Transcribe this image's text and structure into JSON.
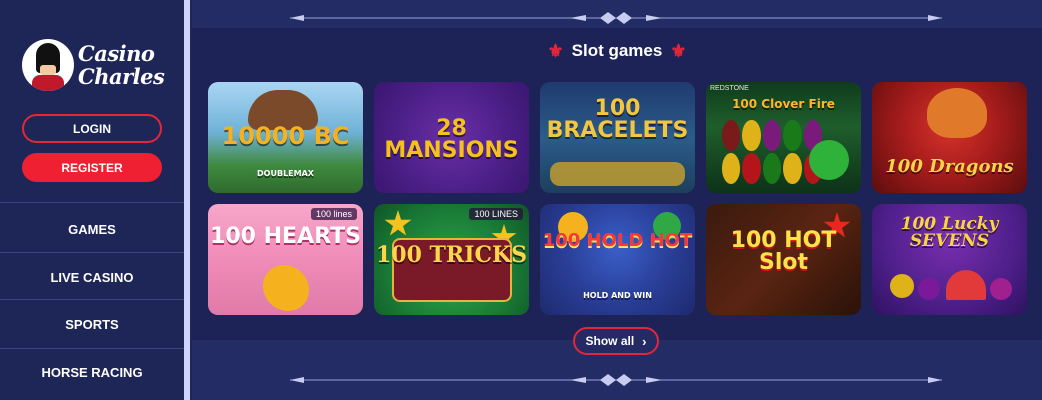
{
  "logo": {
    "line1": "Casino",
    "line2": "Charles"
  },
  "auth": {
    "login_label": "LOGIN",
    "register_label": "REGISTER"
  },
  "nav": [
    {
      "label": "GAMES"
    },
    {
      "label": "LIVE CASINO"
    },
    {
      "label": "SPORTS"
    },
    {
      "label": "HORSE RACING"
    }
  ],
  "section": {
    "title": "Slot games",
    "fleur": "⚜",
    "show_all_label": "Show all",
    "show_all_icon": "chevron-right-icon"
  },
  "games": [
    {
      "title": "10000 BC",
      "subtitle": "DOUBLEMAX",
      "tag": "",
      "brand": ""
    },
    {
      "title": "28 MANSIONS",
      "subtitle": "",
      "tag": "",
      "brand": ""
    },
    {
      "title": "100 BRACELETS",
      "subtitle": "",
      "tag": "",
      "brand": ""
    },
    {
      "title": "100 Clover Fire",
      "subtitle": "",
      "tag": "",
      "brand": "REDSTONE"
    },
    {
      "title": "100 Dragons",
      "subtitle": "",
      "tag": "",
      "brand": ""
    },
    {
      "title": "100 HEARTS",
      "subtitle": "",
      "tag": "100 lines",
      "brand": ""
    },
    {
      "title": "100 TRICKS",
      "subtitle": "",
      "tag": "100 LINES",
      "brand": ""
    },
    {
      "title": "100 HOLD HOT",
      "subtitle": "HOLD AND WIN",
      "tag": "",
      "brand": ""
    },
    {
      "title": "100 HOT Slot",
      "subtitle": "",
      "tag": "",
      "brand": ""
    },
    {
      "title": "100 Lucky SEVENS",
      "subtitle": "",
      "tag": "",
      "brand": ""
    }
  ],
  "colors": {
    "accent": "#e3263a",
    "background": "#242c66",
    "sidebar": "#1e2658"
  }
}
